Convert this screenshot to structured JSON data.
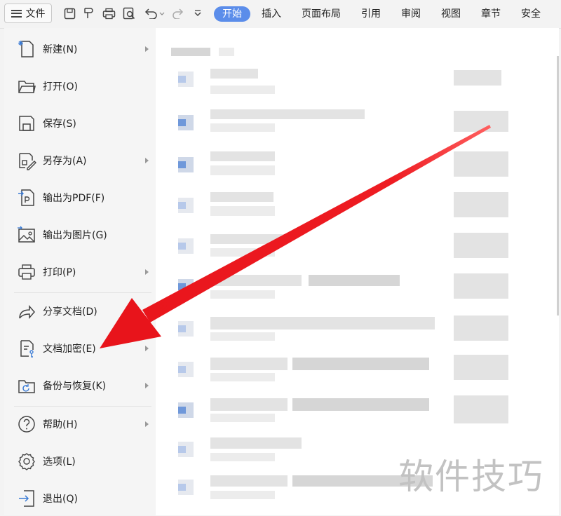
{
  "toolbar": {
    "file_label": "文件",
    "tabs": [
      "开始",
      "插入",
      "页面布局",
      "引用",
      "审阅",
      "视图",
      "章节",
      "安全"
    ],
    "active_tab": "开始"
  },
  "menu": {
    "items": [
      {
        "label": "新建(N)",
        "icon": "new-document-icon",
        "submenu": true
      },
      {
        "label": "打开(O)",
        "icon": "folder-open-icon",
        "submenu": false
      },
      {
        "label": "保存(S)",
        "icon": "save-icon",
        "submenu": false
      },
      {
        "label": "另存为(A)",
        "icon": "save-as-icon",
        "submenu": true
      },
      {
        "label": "输出为PDF(F)",
        "icon": "export-pdf-icon",
        "submenu": false
      },
      {
        "label": "输出为图片(G)",
        "icon": "export-image-icon",
        "submenu": false
      },
      {
        "label": "打印(P)",
        "icon": "printer-icon",
        "submenu": true
      },
      {
        "label": "分享文档(D)",
        "icon": "share-icon",
        "submenu": false
      },
      {
        "label": "文档加密(E)",
        "icon": "encrypt-icon",
        "submenu": true
      },
      {
        "label": "备份与恢复(K)",
        "icon": "backup-icon",
        "submenu": true
      },
      {
        "label": "帮助(H)",
        "icon": "help-icon",
        "submenu": true
      },
      {
        "label": "选项(L)",
        "icon": "gear-icon",
        "submenu": false
      },
      {
        "label": "退出(Q)",
        "icon": "exit-icon",
        "submenu": false
      }
    ]
  },
  "watermark": "软件技巧",
  "colors": {
    "accent": "#5b8dea",
    "annotation_arrow": "#e8141b"
  }
}
